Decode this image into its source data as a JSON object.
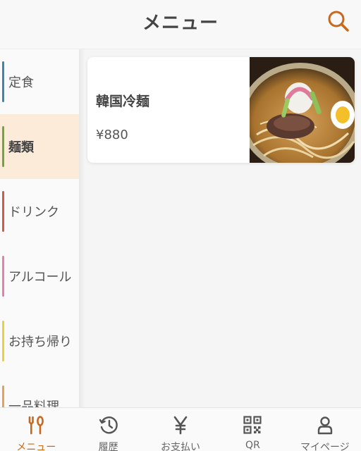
{
  "header": {
    "title": "メニュー",
    "search_icon": "search-icon"
  },
  "categories": [
    {
      "label": "定食",
      "color": "#3b87a8",
      "active": false
    },
    {
      "label": "麺類",
      "color": "#6fa83a",
      "active": true
    },
    {
      "label": "ドリンク",
      "color": "#d35a4a",
      "active": false
    },
    {
      "label": "アルコール",
      "color": "#e57fb0",
      "active": false
    },
    {
      "label": "お持ち帰り",
      "color": "#e8d23a",
      "active": false
    },
    {
      "label": "一品料理",
      "color": "#e8a05a",
      "active": false
    }
  ],
  "items": [
    {
      "name": "韓国冷麺",
      "price": "¥880",
      "image": "cold-noodle-photo"
    }
  ],
  "tabs": [
    {
      "label": "メニュー",
      "icon": "fork-spoon-icon",
      "active": true
    },
    {
      "label": "履歴",
      "icon": "history-icon",
      "active": false
    },
    {
      "label": "お支払い",
      "icon": "yen-icon",
      "active": false
    },
    {
      "label": "QR",
      "icon": "qr-code-icon",
      "active": false
    },
    {
      "label": "マイページ",
      "icon": "person-icon",
      "active": false
    }
  ],
  "colors": {
    "accent": "#c8681e",
    "active_category_bg": "#fdebd9"
  }
}
